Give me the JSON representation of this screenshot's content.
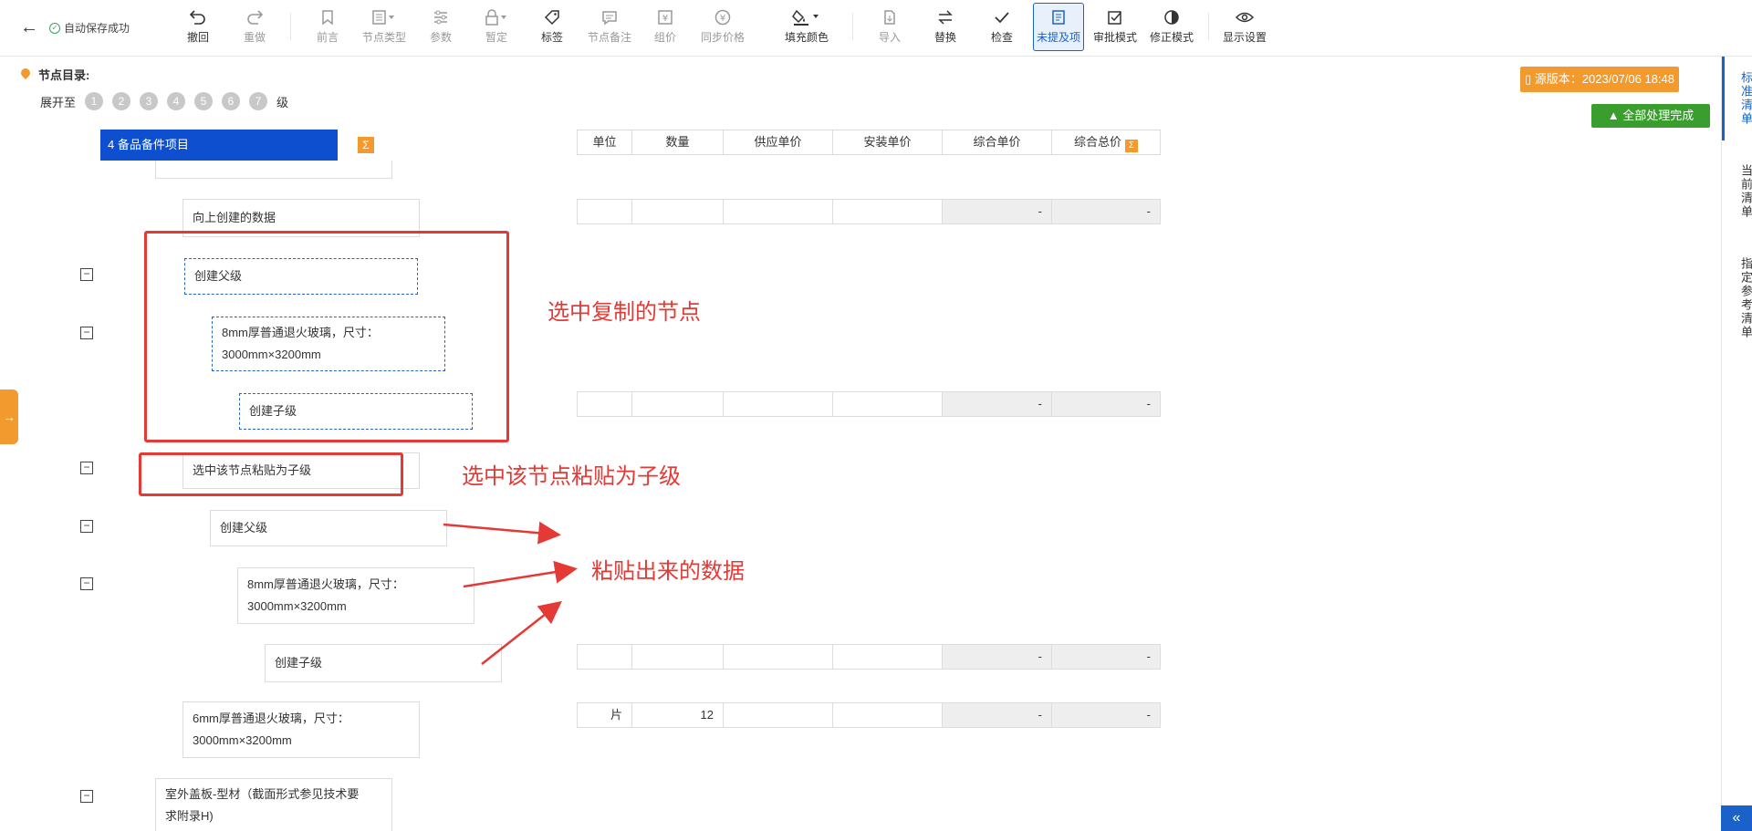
{
  "header": {
    "back_icon": "←",
    "autosave_text": "自动保存成功"
  },
  "toolbar": [
    {
      "label": "撤回",
      "icon": "undo-icon",
      "disabled": false
    },
    {
      "label": "重做",
      "icon": "redo-icon",
      "disabled": true
    },
    {
      "label": "前言",
      "icon": "bookmark-icon",
      "disabled": true
    },
    {
      "label": "节点类型",
      "icon": "node-type-icon",
      "disabled": true
    },
    {
      "label": "参数",
      "icon": "sliders-icon",
      "disabled": true
    },
    {
      "label": "暂定",
      "icon": "lock-icon",
      "disabled": true
    },
    {
      "label": "标签",
      "icon": "tag-icon",
      "disabled": false
    },
    {
      "label": "节点备注",
      "icon": "comment-icon",
      "disabled": true
    },
    {
      "label": "组价",
      "icon": "price-icon",
      "disabled": true
    },
    {
      "label": "同步价格",
      "icon": "sync-price-icon",
      "disabled": true
    },
    {
      "label": "填充颜色",
      "icon": "fill-color-icon",
      "disabled": false
    },
    {
      "label": "导入",
      "icon": "import-icon",
      "disabled": true
    },
    {
      "label": "替换",
      "icon": "replace-icon",
      "disabled": false
    },
    {
      "label": "检查",
      "icon": "check-icon",
      "disabled": false
    },
    {
      "label": "未提及项",
      "icon": "unmentioned-icon",
      "disabled": false,
      "active": true
    },
    {
      "label": "审批模式",
      "icon": "approve-icon",
      "disabled": false
    },
    {
      "label": "修正模式",
      "icon": "revise-icon",
      "disabled": false
    },
    {
      "label": "显示设置",
      "icon": "eye-icon",
      "disabled": false
    }
  ],
  "right_tabs": [
    "标准清单",
    "当前清单",
    "指定参考清单"
  ],
  "collapse_icon": "«",
  "side_expand_icon": "→",
  "directory": {
    "title": "节点目录:",
    "expand_label": "展开至",
    "levels": [
      "1",
      "2",
      "3",
      "4",
      "5",
      "6",
      "7"
    ],
    "level_suffix": "级"
  },
  "version_label": "源版本：2023/07/06 18:48",
  "done_label": "全部处理完成",
  "root_node": "4 备品备件项目",
  "sum_icon": "Σ",
  "columns": [
    "单位",
    "数量",
    "供应单价",
    "安装单价",
    "综合单价",
    "综合总价"
  ],
  "nodes": {
    "n1": "向上创建的数据",
    "n2": "创建父级",
    "n3a": "8mm厚普通退火玻璃，尺寸：",
    "n3b": "3000mm×3200mm",
    "n4": "创建子级",
    "n5": "选中该节点粘贴为子级",
    "n6": "创建父级",
    "n7a": "8mm厚普通退火玻璃，尺寸：",
    "n7b": "3000mm×3200mm",
    "n8": "创建子级",
    "n9a": "6mm厚普通退火玻璃，尺寸：",
    "n9b": "3000mm×3200mm",
    "n10a": "室外盖板-型材（截面形式参见技术要",
    "n10b": "求附录H)"
  },
  "toggle_symbol": "−",
  "rows": {
    "row1": {
      "unit": "",
      "qty": "",
      "supply": "",
      "install": "",
      "unit_price": "-",
      "total": "-"
    },
    "row4": {
      "unit": "",
      "qty": "",
      "supply": "",
      "install": "",
      "unit_price": "-",
      "total": "-"
    },
    "row8": {
      "unit": "",
      "qty": "",
      "supply": "",
      "install": "",
      "unit_price": "-",
      "total": "-"
    },
    "row9": {
      "unit": "片",
      "qty": "12",
      "supply": "",
      "install": "",
      "unit_price": "-",
      "total": "-"
    }
  },
  "annotations": {
    "copy": "选中复制的节点",
    "paste": "选中该节点粘贴为子级",
    "result": "粘贴出来的数据"
  },
  "colors": {
    "primary": "#1a62c9",
    "root_node": "#0e4fcf",
    "accent": "#f29a2e",
    "success": "#3a9e2f",
    "annotation": "#e53935"
  }
}
